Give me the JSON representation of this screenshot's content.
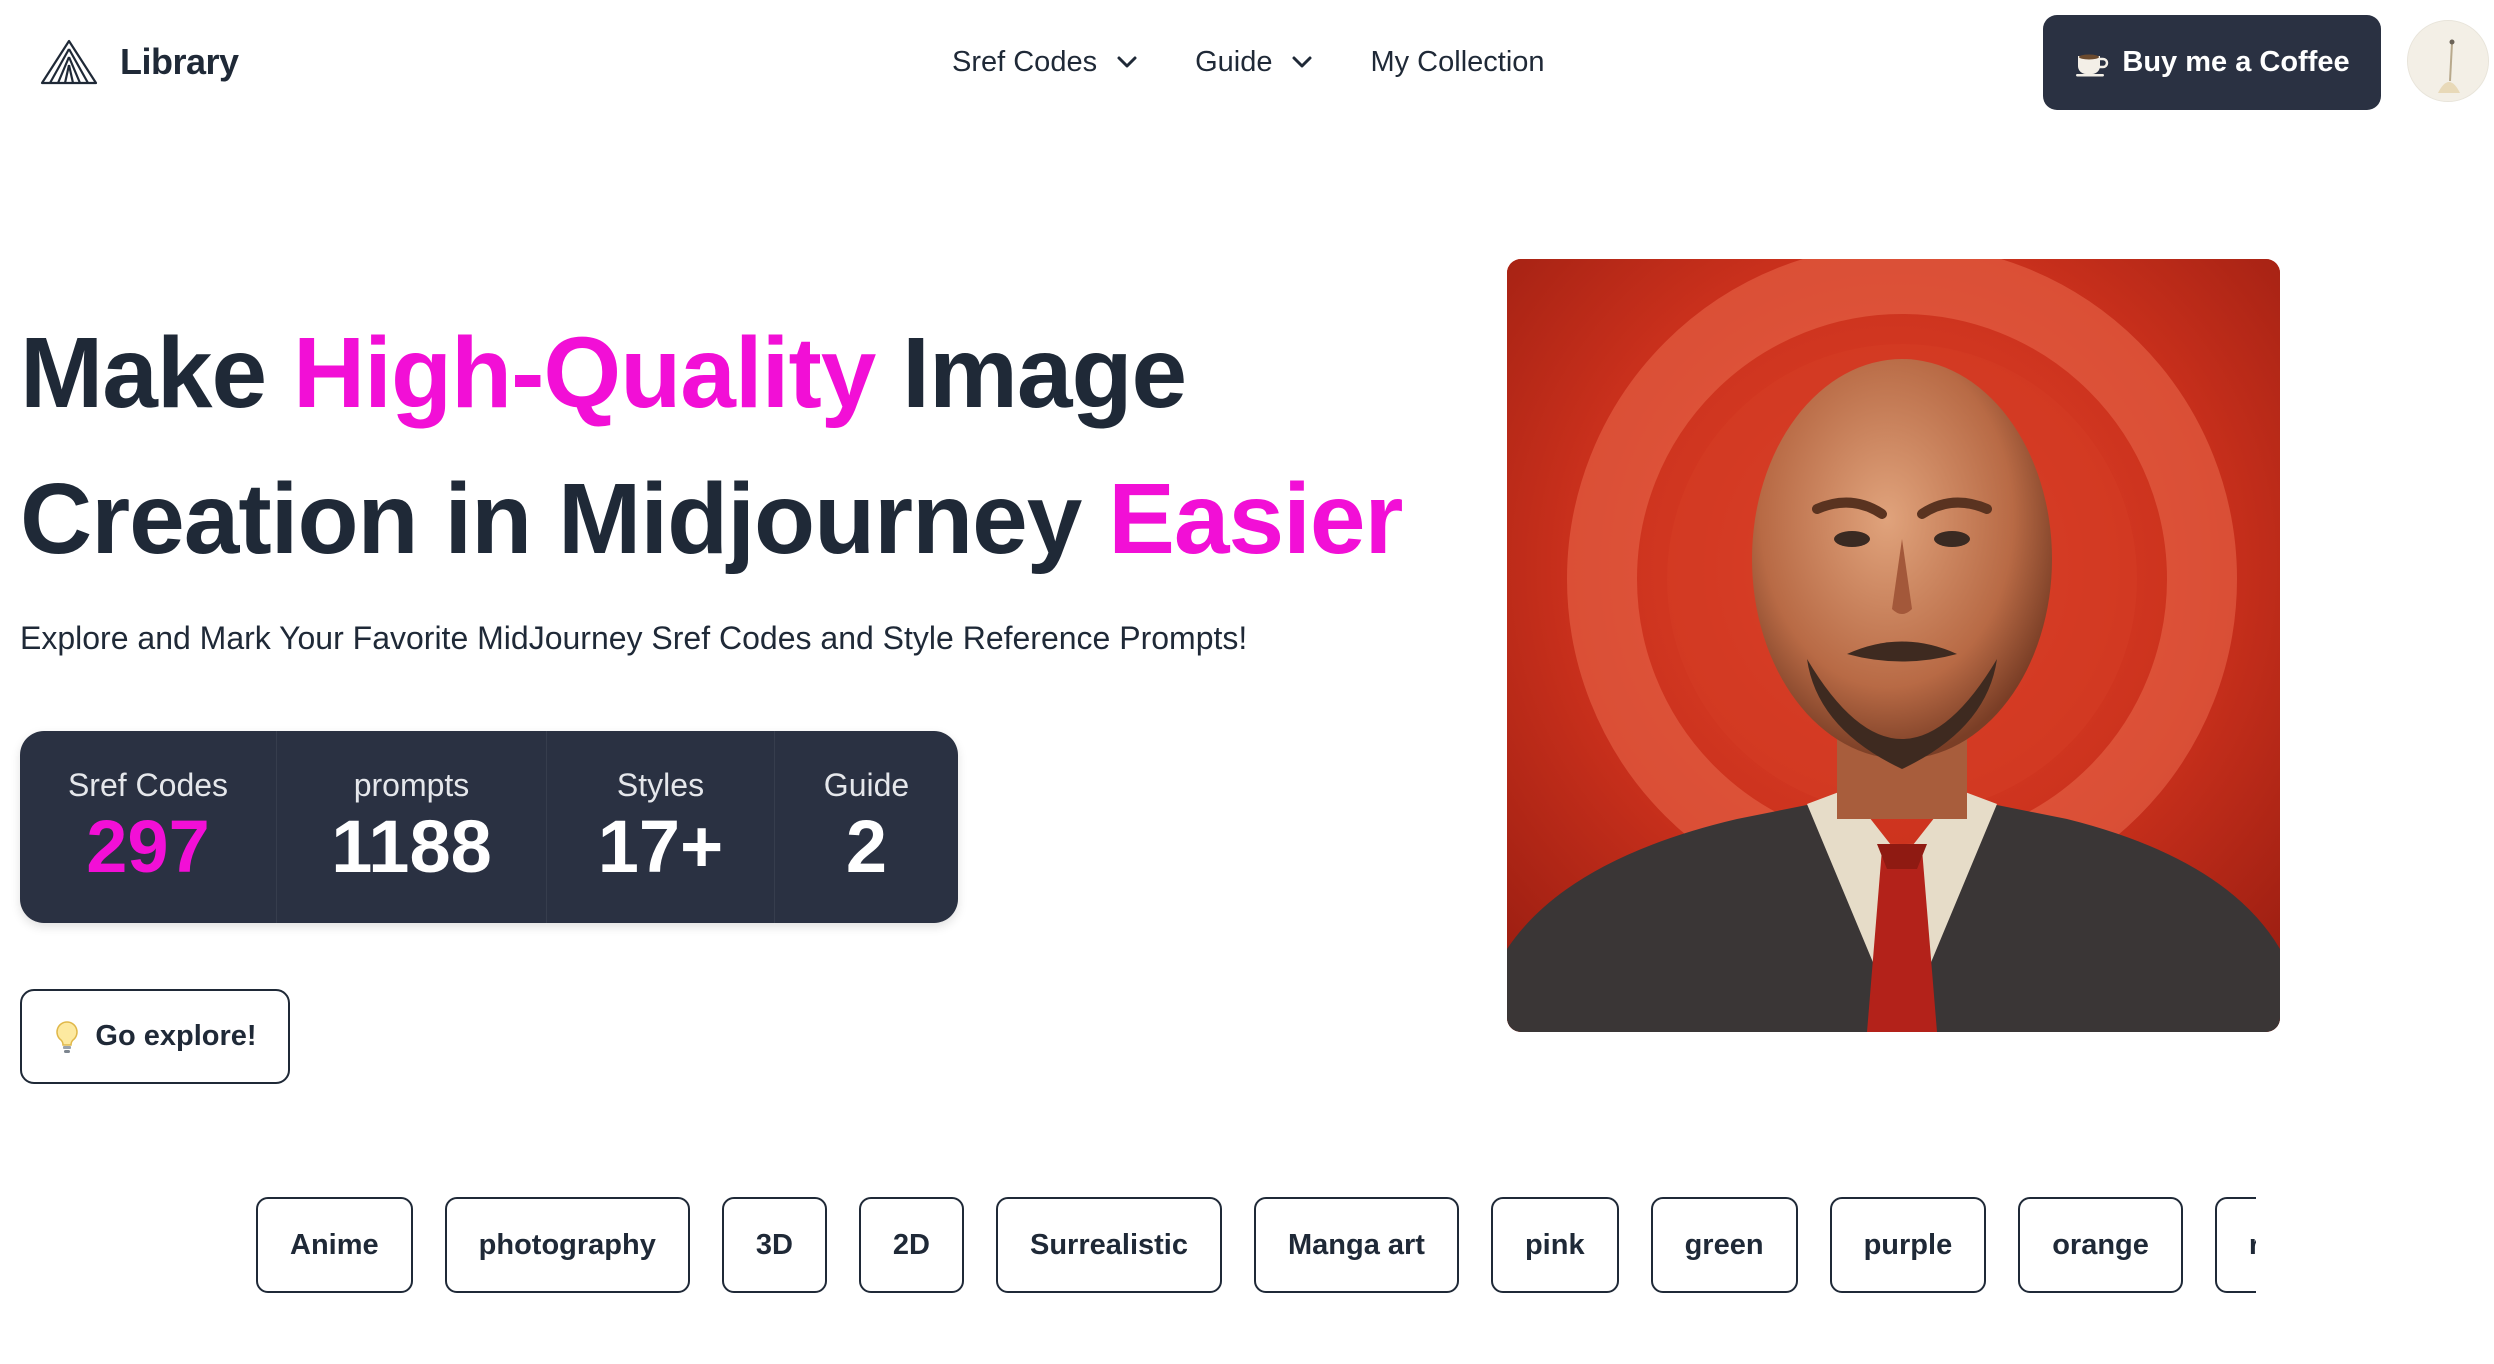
{
  "brand": {
    "name": "Library"
  },
  "nav": {
    "items": [
      {
        "label": "Sref Codes",
        "has_dropdown": true
      },
      {
        "label": "Guide",
        "has_dropdown": true
      },
      {
        "label": "My Collection",
        "has_dropdown": false
      }
    ],
    "coffee_label": "Buy me a Coffee"
  },
  "hero": {
    "title_part1": "Make ",
    "title_accent1": "High-Quality",
    "title_part2": " Image Creation in Midjourney ",
    "title_accent2": "Easier",
    "subtitle": "Explore and Mark Your Favorite MidJourney Sref Codes and Style Reference Prompts!",
    "explore_label": "Go explore!"
  },
  "stats": [
    {
      "label": "Sref Codes",
      "value": "297",
      "highlight": true
    },
    {
      "label": "prompts",
      "value": "1188",
      "highlight": false
    },
    {
      "label": "Styles",
      "value": "17+",
      "highlight": false
    },
    {
      "label": "Guide",
      "value": "2",
      "highlight": false
    }
  ],
  "tags": [
    "Anime",
    "photography",
    "3D",
    "2D",
    "Surrealistic",
    "Manga art",
    "pink",
    "green",
    "purple",
    "orange",
    "red"
  ],
  "colors": {
    "accent": "#f20fd6",
    "dark": "#2a3142",
    "text": "#1f2937"
  },
  "icons": {
    "brand": "library-logo-icon",
    "dropdown": "chevron-down-icon",
    "coffee": "coffee-cup-icon",
    "explore": "lightbulb-icon"
  }
}
